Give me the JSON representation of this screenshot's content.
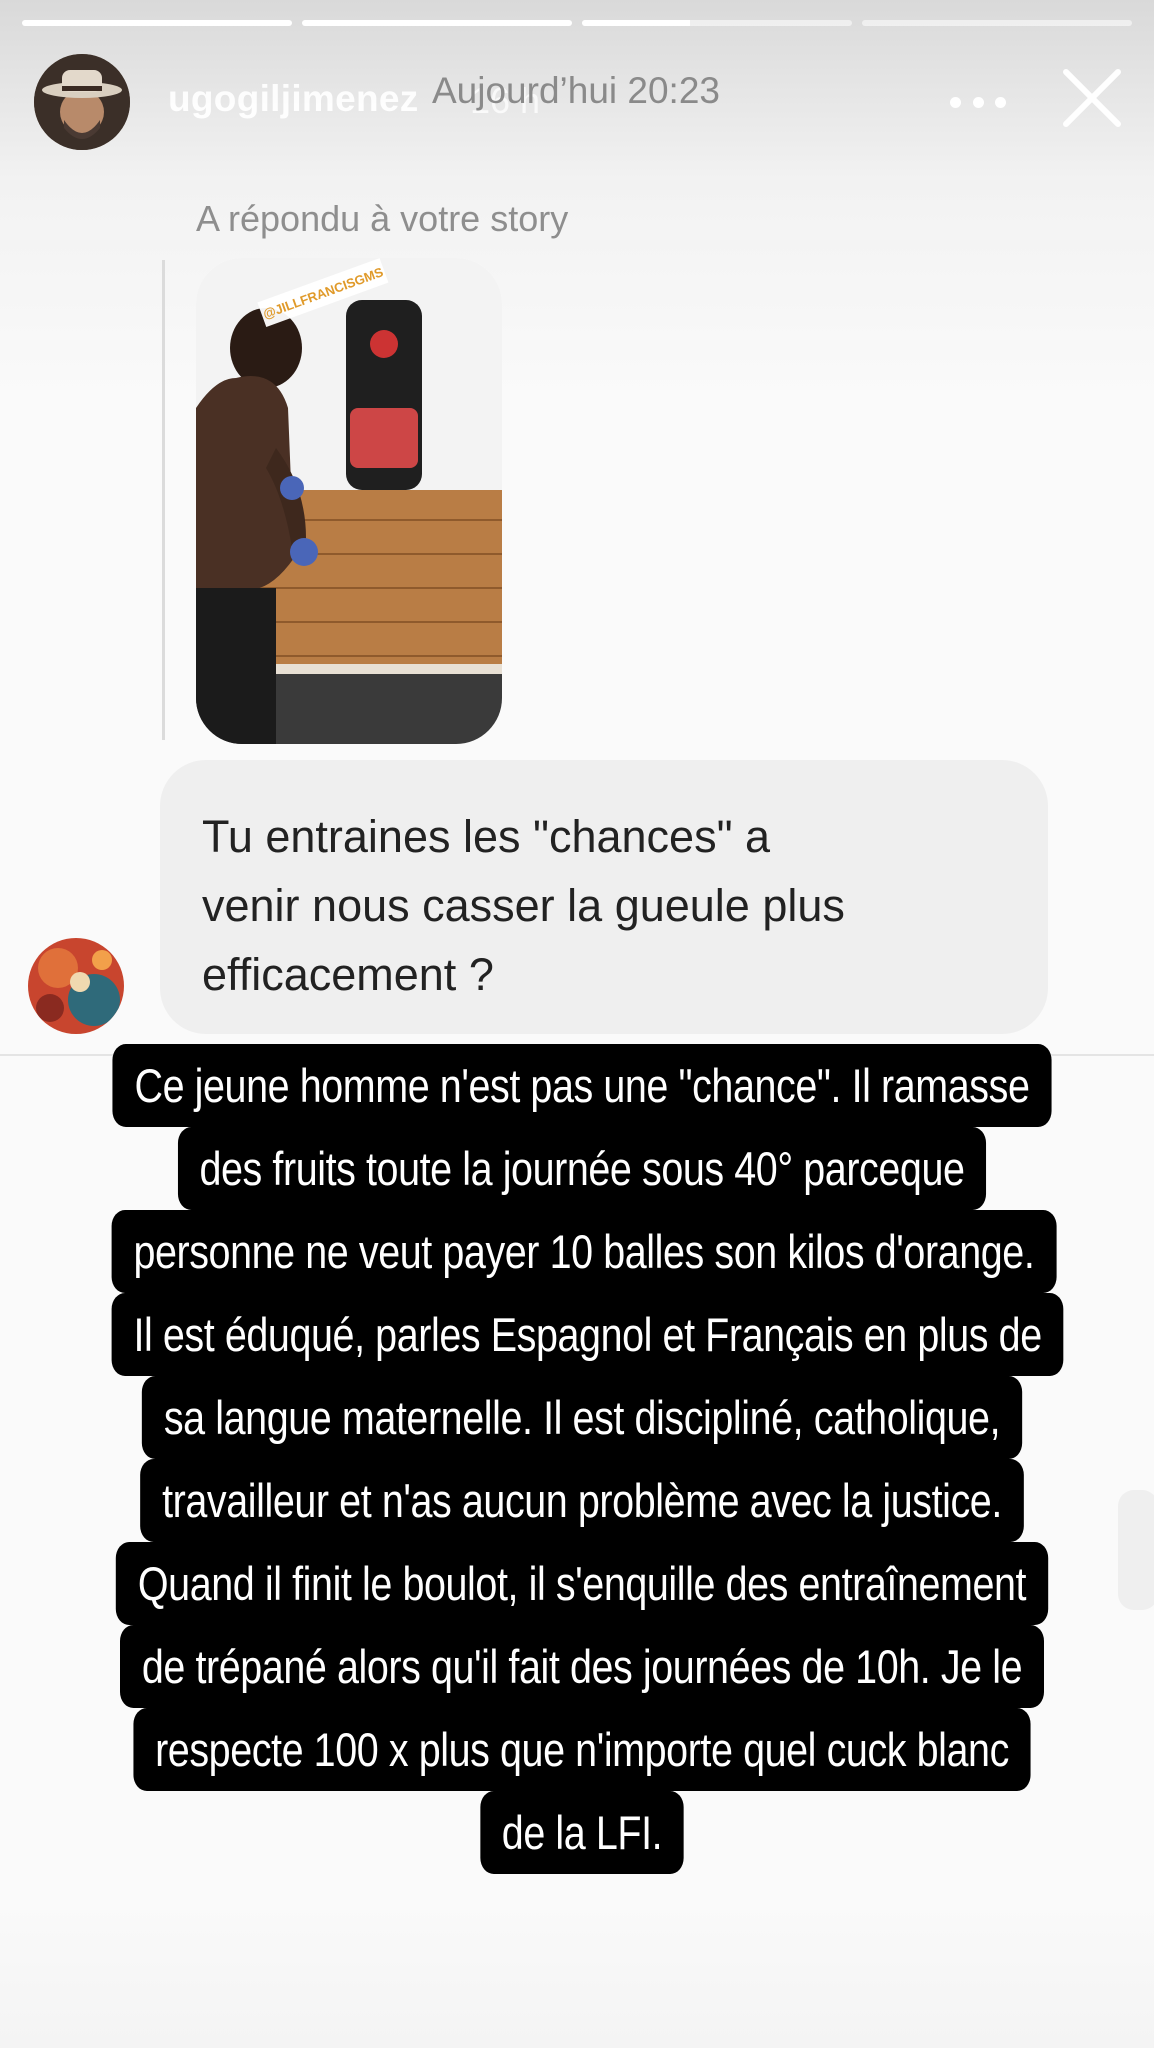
{
  "story": {
    "progress": [
      {
        "fill": 1.0
      },
      {
        "fill": 1.0
      },
      {
        "fill": 0.4
      },
      {
        "fill": 0.0
      }
    ],
    "username": "ugogiljimenez",
    "elapsed": "16 h",
    "icons": {
      "menu": "more-horizontal-icon",
      "close": "close-icon"
    }
  },
  "dm": {
    "timestamp": "Aujourd’hui 20:23",
    "reply_label": "A répondu à votre story",
    "story_tag": "@JILLFRANCISGMS",
    "message": "Tu entraines les \"chances\" a\nvenir nous casser la gueule plus\nefficacement ?"
  },
  "caption": {
    "lines": [
      "Ce jeune homme n'est pas une \"chance\". Il ramasse",
      "des fruits toute la journée sous 40° parceque",
      "personne ne veut payer 10 balles son kilos d'orange.",
      "Il est éduqué, parles Espagnol et Français en plus de",
      "sa langue maternelle. Il est discipliné, catholique,",
      "travailleur et n'as aucun problème avec la justice.",
      "Quand il finit le boulot, il s'enquille des entraînement",
      "de trépané alors qu'il fait des journées de 10h. Je le",
      "respecte 100 x plus que n'importe  quel cuck blanc",
      "de la LFI."
    ]
  }
}
